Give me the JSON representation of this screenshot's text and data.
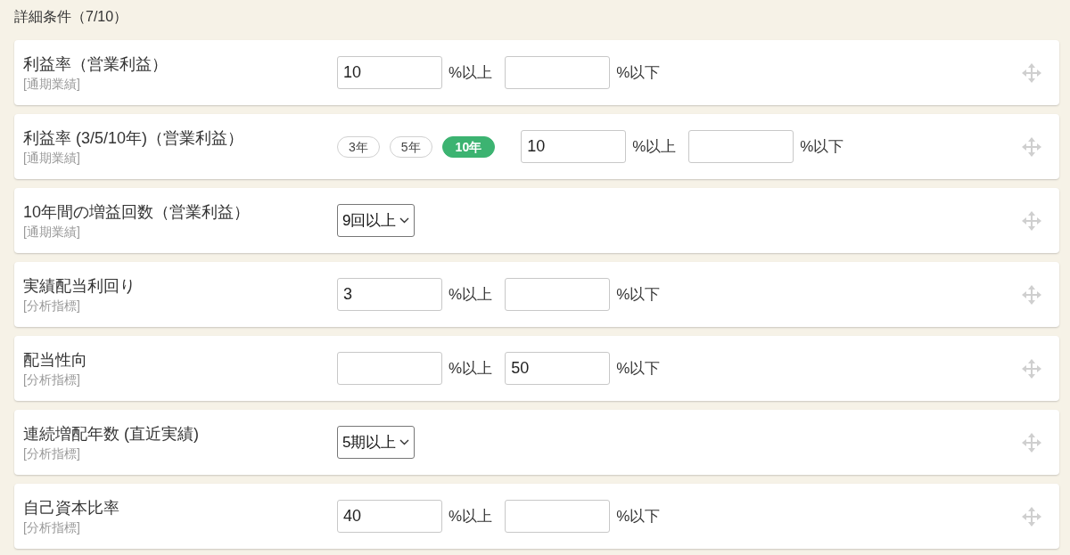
{
  "heading": "詳細条件（7/10）",
  "conditions": [
    {
      "kind": "range",
      "title": "利益率（営業利益）",
      "category": "[通期業績]",
      "min": "10",
      "min_unit": "%以上",
      "max_unit": "%以下"
    },
    {
      "kind": "period_range",
      "title": "利益率 (3/5/10年)（営業利益）",
      "category": "[通期業績]",
      "periods": [
        {
          "label": "3年",
          "selected": false
        },
        {
          "label": "5年",
          "selected": false
        },
        {
          "label": "10年",
          "selected": true
        }
      ],
      "min": "10",
      "min_unit": "%以上",
      "max_unit": "%以下"
    },
    {
      "kind": "select",
      "title": "10年間の増益回数（営業利益）",
      "category": "[通期業績]",
      "value": "9回以上"
    },
    {
      "kind": "range",
      "title": "実績配当利回り",
      "category": "[分析指標]",
      "min": "3",
      "min_unit": "%以上",
      "max_unit": "%以下"
    },
    {
      "kind": "range",
      "title": "配当性向",
      "category": "[分析指標]",
      "min_unit": "%以上",
      "max": "50",
      "max_unit": "%以下"
    },
    {
      "kind": "select",
      "title": "連続増配年数 (直近実績)",
      "category": "[分析指標]",
      "value": "5期以上"
    },
    {
      "kind": "range",
      "title": "自己資本比率",
      "category": "[分析指標]",
      "min": "40",
      "min_unit": "%以上",
      "max_unit": "%以下"
    }
  ]
}
